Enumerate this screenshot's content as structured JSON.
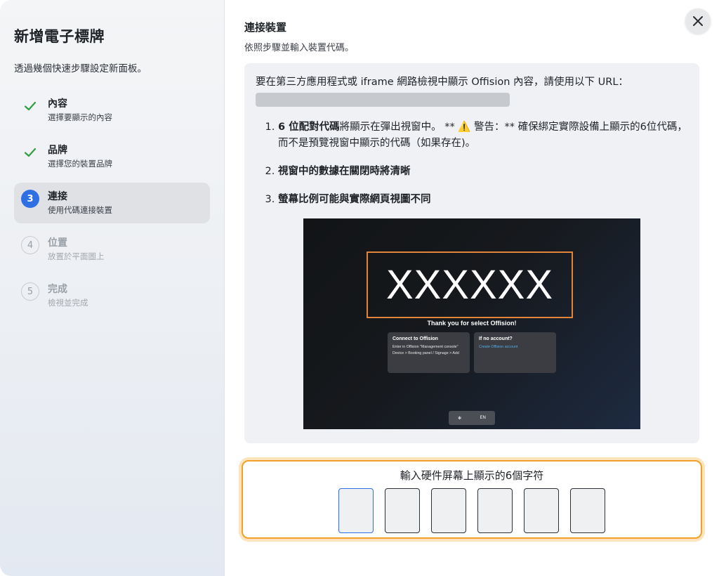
{
  "sidebar": {
    "title": "新增電子標牌",
    "subtitle": "透過幾個快速步驟設定新面板。",
    "steps": [
      {
        "number": "1",
        "label": "內容",
        "desc": "選擇要顯示的內容",
        "status": "done"
      },
      {
        "number": "2",
        "label": "品牌",
        "desc": "選擇您的裝置品牌",
        "status": "done"
      },
      {
        "number": "3",
        "label": "連接",
        "desc": "使用代碼連接裝置",
        "status": "current"
      },
      {
        "number": "4",
        "label": "位置",
        "desc": "放置於平面圖上",
        "status": "pending"
      },
      {
        "number": "5",
        "label": "完成",
        "desc": "檢視並完成",
        "status": "pending"
      }
    ]
  },
  "main": {
    "title": "連接裝置",
    "subtitle": "依照步驟並輸入裝置代碼。",
    "info_text": "要在第三方應用程式或 iframe 網路檢視中顯示 Offision 內容，請使用以下 URL：",
    "notes": [
      {
        "bold": "6 位配對代碼",
        "rest": "將顯示在彈出視窗中。 ** ⚠️ 警告：** 確保綁定實際設備上顯示的6位代碼，而不是預覽視窗中顯示的代碼（如果存在)。"
      },
      {
        "bold": "視窗中的數據在關閉時將清晰",
        "rest": ""
      },
      {
        "bold": "螢幕比例可能與實際網頁視圖不同",
        "rest": ""
      }
    ],
    "preview": {
      "code": "XXXXXX",
      "thanks": "Thank you for select Offision!",
      "card1_title": "Connect to Offision",
      "card1_body": "Enter in Offision \"Management console\" Device > Booking panel / Signage > Add",
      "card2_title": "If no account?",
      "card2_link": "Create Offision account",
      "bar_icon": "✻",
      "bar_lang": "EN"
    },
    "code_label": "輸入硬件屏幕上顯示的6個字符",
    "code_values": [
      "",
      "",
      "",
      "",
      "",
      ""
    ]
  },
  "icons": {
    "close": "close-icon",
    "check": "check-icon"
  },
  "colors": {
    "accent": "#2f6fe4",
    "check": "#2ea043",
    "highlight": "#f0a02b",
    "preview_border": "#e2843a"
  }
}
